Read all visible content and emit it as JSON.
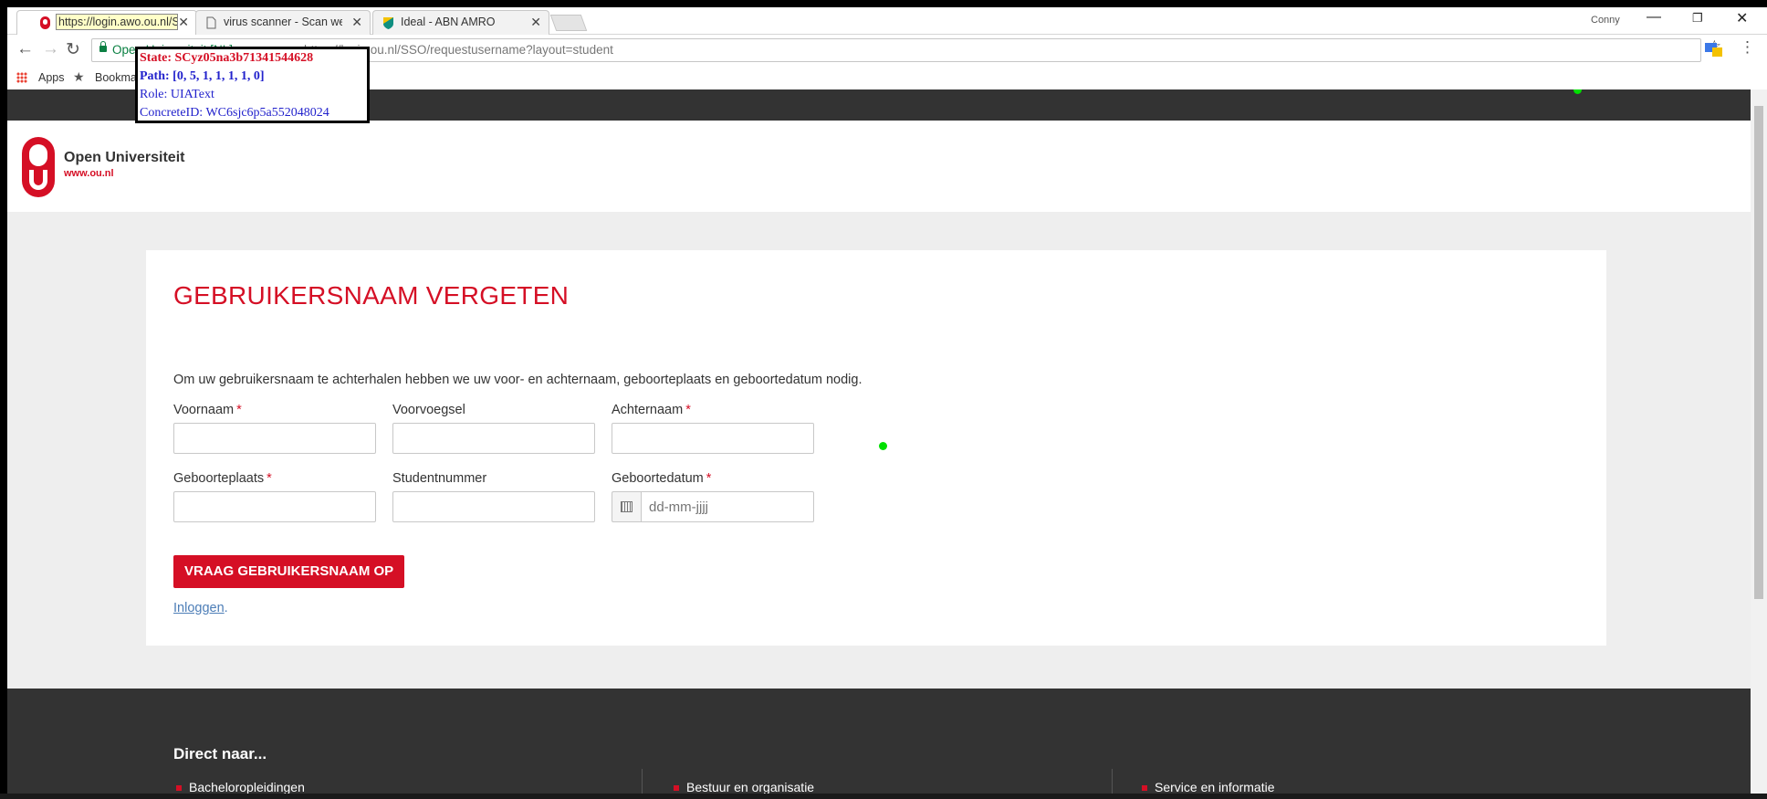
{
  "browser": {
    "tabs": [
      {
        "title": "https://login.awo.ou.nl/S",
        "close": "✕"
      },
      {
        "title": "virus scanner - Scan web",
        "close": "✕"
      },
      {
        "title": "Ideal - ABN AMRO",
        "close": "✕"
      }
    ],
    "user": "Conny",
    "window_controls": {
      "minimize": "—",
      "restore": "❐",
      "close": "✕"
    },
    "omnibox": {
      "secure_label": "Open Universiteit [NL]",
      "url": "https://login.ou.nl/SSO/requestusername?layout=student"
    },
    "bookmarks": {
      "apps": "Apps",
      "bookmarks": "Bookmarks"
    }
  },
  "overlay": {
    "state": "State: SCyz05na3b71341544628",
    "path": "Path: [0, 5, 1, 1, 1, 1, 0]",
    "role": "Role: UIAText",
    "concrete_id": "ConcreteID: WC6sjc6p5a552048024"
  },
  "header": {
    "brand_name": "Open Universiteit",
    "brand_url": "www.ou.nl"
  },
  "form": {
    "title": "GEBRUIKERSNAAM VERGETEN",
    "intro": "Om uw gebruikersnaam te achterhalen hebben we uw voor- en achternaam, geboorteplaats en geboortedatum nodig.",
    "required_mark": "*",
    "fields": {
      "voornaam": {
        "label": "Voornaam",
        "value": ""
      },
      "voorvoegsel": {
        "label": "Voorvoegsel",
        "value": ""
      },
      "achternaam": {
        "label": "Achternaam",
        "value": ""
      },
      "geboorteplaats": {
        "label": "Geboorteplaats",
        "value": ""
      },
      "studentnummer": {
        "label": "Studentnummer",
        "value": ""
      },
      "geboortedatum": {
        "label": "Geboortedatum",
        "value": "",
        "placeholder": "dd-mm-jjjj"
      }
    },
    "submit_label": "VRAAG GEBRUIKERSNAAM OP",
    "login_link": "Inloggen",
    "login_suffix": "."
  },
  "footer": {
    "title": "Direct naar...",
    "items": [
      "Bacheloropleidingen",
      "Bestuur en organisatie",
      "Service en informatie"
    ]
  },
  "colors": {
    "brand_red": "#d50f25",
    "dark_bar": "#333333",
    "link_blue": "#4d7eb7"
  }
}
